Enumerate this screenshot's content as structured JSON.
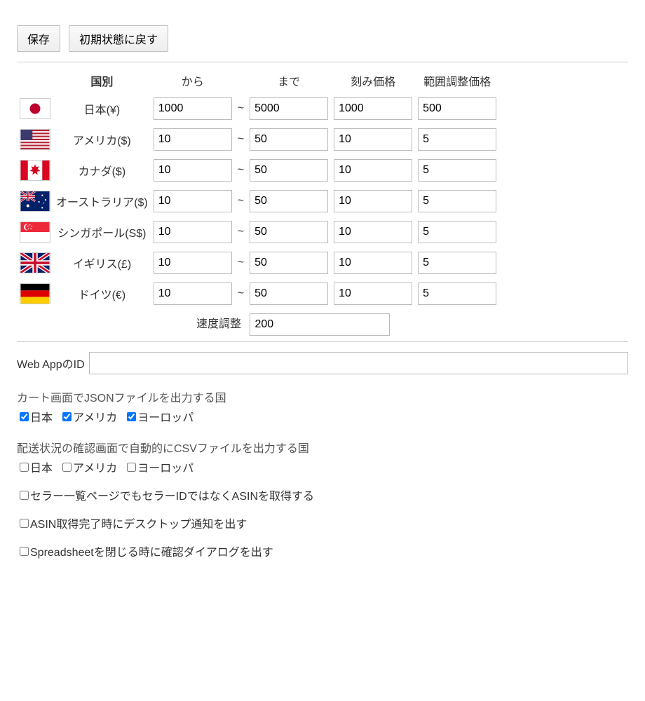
{
  "buttons": {
    "save": "保存",
    "reset": "初期状態に戻す"
  },
  "headers": {
    "country": "国別",
    "from": "から",
    "to": "まで",
    "step": "刻み価格",
    "range": "範囲調整価格"
  },
  "rows": [
    {
      "flag": "jp",
      "name": "日本(¥)",
      "from": "1000",
      "to": "5000",
      "step": "1000",
      "range": "500"
    },
    {
      "flag": "us",
      "name": "アメリカ($)",
      "from": "10",
      "to": "50",
      "step": "10",
      "range": "5"
    },
    {
      "flag": "ca",
      "name": "カナダ($)",
      "from": "10",
      "to": "50",
      "step": "10",
      "range": "5"
    },
    {
      "flag": "au",
      "name": "オーストラリア($)",
      "from": "10",
      "to": "50",
      "step": "10",
      "range": "5"
    },
    {
      "flag": "sg",
      "name": "シンガポール(S$)",
      "from": "10",
      "to": "50",
      "step": "10",
      "range": "5"
    },
    {
      "flag": "uk",
      "name": "イギリス(£)",
      "from": "10",
      "to": "50",
      "step": "10",
      "range": "5"
    },
    {
      "flag": "de",
      "name": "ドイツ(€)",
      "from": "10",
      "to": "50",
      "step": "10",
      "range": "5"
    }
  ],
  "speed": {
    "label": "速度調整",
    "value": "200"
  },
  "webapp": {
    "label": "Web AppのID",
    "value": ""
  },
  "json_out": {
    "title": "カート画面でJSONファイルを出力する国",
    "opts": [
      {
        "label": "日本",
        "checked": true
      },
      {
        "label": "アメリカ",
        "checked": true
      },
      {
        "label": "ヨーロッパ",
        "checked": true
      }
    ]
  },
  "csv_out": {
    "title": "配送状況の確認画面で自動的にCSVファイルを出力する国",
    "opts": [
      {
        "label": "日本",
        "checked": false
      },
      {
        "label": "アメリカ",
        "checked": false
      },
      {
        "label": "ヨーロッパ",
        "checked": false
      }
    ]
  },
  "misc_opts": [
    {
      "label": "セラー一覧ページでもセラーIDではなくASINを取得する",
      "checked": false
    },
    {
      "label": "ASIN取得完了時にデスクトップ通知を出す",
      "checked": false
    },
    {
      "label": "Spreadsheetを閉じる時に確認ダイアログを出す",
      "checked": false
    }
  ]
}
